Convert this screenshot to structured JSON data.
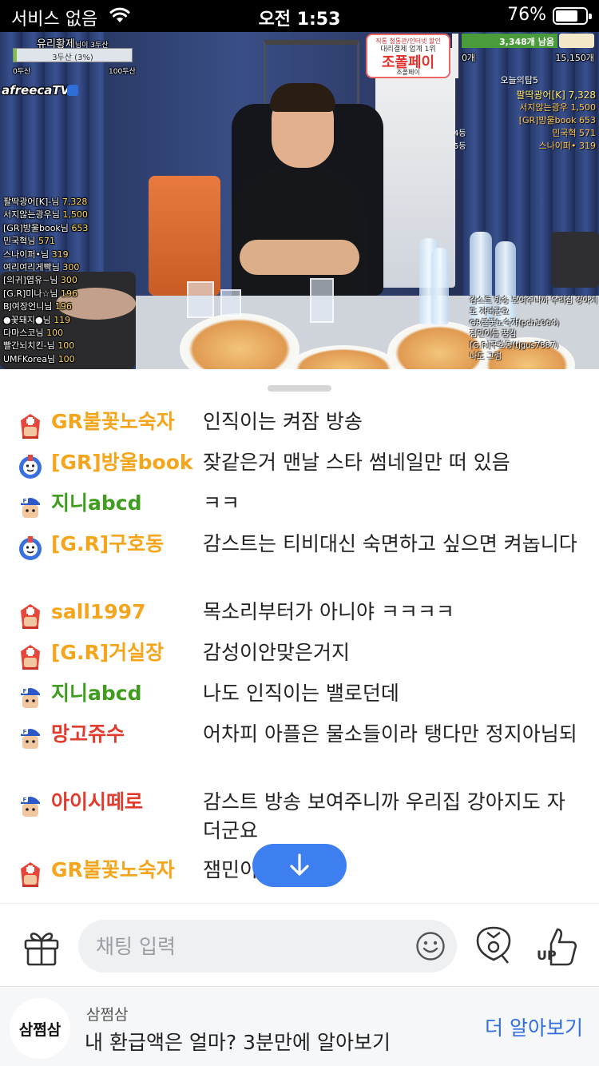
{
  "status_bar": {
    "carrier": "서비스 없음",
    "time": "오전 1:53",
    "battery_percent_text": "76%",
    "battery_level": 0.76
  },
  "video": {
    "goal": {
      "title": "유리황제",
      "title_suffix": "님이 3두산",
      "bar_label": "3두산 (3%)",
      "progress": 0.03,
      "min_label": "0두산",
      "max_label": "100두산"
    },
    "platform_logo": "afreecaTV",
    "donor_list": [
      {
        "name": "팔딱광어[K]-님",
        "amount": "7,328"
      },
      {
        "name": "서지않는광우님",
        "amount": "1,500"
      },
      {
        "name": "[GR]방울book님",
        "amount": "653"
      },
      {
        "name": "민국혁님",
        "amount": "571"
      },
      {
        "name": "스나이퍼•님",
        "amount": "319"
      },
      {
        "name": "여리여리게빡님",
        "amount": "300"
      },
      {
        "name": "[의귀]엽유~님",
        "amount": "300"
      },
      {
        "name": "[G.R]미나☆님",
        "amount": "196"
      },
      {
        "name": "BJ여장언니님",
        "amount": "196"
      },
      {
        "name": "●꽃돼지●님",
        "amount": "119"
      },
      {
        "name": "다마스코님",
        "amount": "100"
      },
      {
        "name": "빨간뇌치킨-님",
        "amount": "100"
      },
      {
        "name": "UMFKorea님",
        "amount": "100"
      }
    ],
    "ad_banner": {
      "line1": "직통 철통관/인터넷 할인",
      "line2": "대리결제 업계 1위",
      "brand": "조폴페이",
      "footer": "조폴페이"
    },
    "counter": {
      "remaining": "3,348개 남음",
      "zero": "0개",
      "total": "15,150개"
    },
    "top5": {
      "title": "오늘의탑5",
      "rows": [
        {
          "rank": "",
          "name": "팔딱광어[K]",
          "amount": "7,328"
        },
        {
          "rank": "",
          "name": "서지않는광우",
          "amount": "1,500"
        },
        {
          "rank": "",
          "name": "[GR]방울book",
          "amount": "653"
        },
        {
          "rank": "4등",
          "name": "민국혁",
          "amount": "571"
        },
        {
          "rank": "5등",
          "name": "스나이퍼•",
          "amount": "319"
        }
      ]
    },
    "live_chat": [
      "감스트 방송 보여주니까 우리집 강아지",
      "도 자더군요",
      "GR불꽃노숙자(pch1064)",
      "잼민이들 꿈컴",
      "[G.R]구호동(tjgus7887)",
      "나도 그럼"
    ]
  },
  "chat": {
    "messages": [
      {
        "nick": "GR불꽃노숙자",
        "color": "orange",
        "badge": "red",
        "text": "인직이는 켜잠 방송"
      },
      {
        "nick": "[GR]방울book",
        "color": "orange",
        "badge": "blue",
        "text": "잦같은거 맨날 스타 썸네일만 떠 있음"
      },
      {
        "nick": "지니abcd",
        "color": "green",
        "badge": "fan",
        "text": "ㅋㅋ"
      },
      {
        "nick": "[G.R]구호동",
        "color": "orange",
        "badge": "blue",
        "text": "감스트는 티비대신 숙면하고 싶으면 켜놉니다"
      },
      {
        "nick": "sall1997",
        "color": "orange",
        "badge": "red",
        "text": "목소리부터가 아니야 ㅋㅋㅋㅋ"
      },
      {
        "nick": "[G.R]거실장",
        "color": "orange",
        "badge": "red",
        "text": "감성이안맞은거지"
      },
      {
        "nick": "지니abcd",
        "color": "green",
        "badge": "fan",
        "text": "나도 인직이는 밸로던데"
      },
      {
        "nick": "망고쥬수",
        "color": "red",
        "badge": "fan",
        "text": "어차피 아플은 물소들이라 탱다만 정지아님되"
      },
      {
        "nick": "아이시떼로",
        "color": "red",
        "badge": "fan",
        "text": "감스트 방송 보여주니까 우리집 강아지도 자더군요"
      },
      {
        "nick": "GR불꽃노숙자",
        "color": "orange",
        "badge": "red",
        "text": "잼민이"
      }
    ]
  },
  "input_bar": {
    "placeholder": "채팅 입력"
  },
  "bottom_ad": {
    "logo_text": "삼쩜삼",
    "brand": "삼쩜삼",
    "headline": "내 환급액은 얼마? 3분만에 알아보기",
    "cta": "더 알아보기"
  },
  "colors": {
    "nick_orange": "#f5a51c",
    "nick_green": "#3f9d1e",
    "nick_red": "#e23b2d",
    "accent_blue": "#3d7ff1",
    "cta_blue": "#2f6de0"
  }
}
